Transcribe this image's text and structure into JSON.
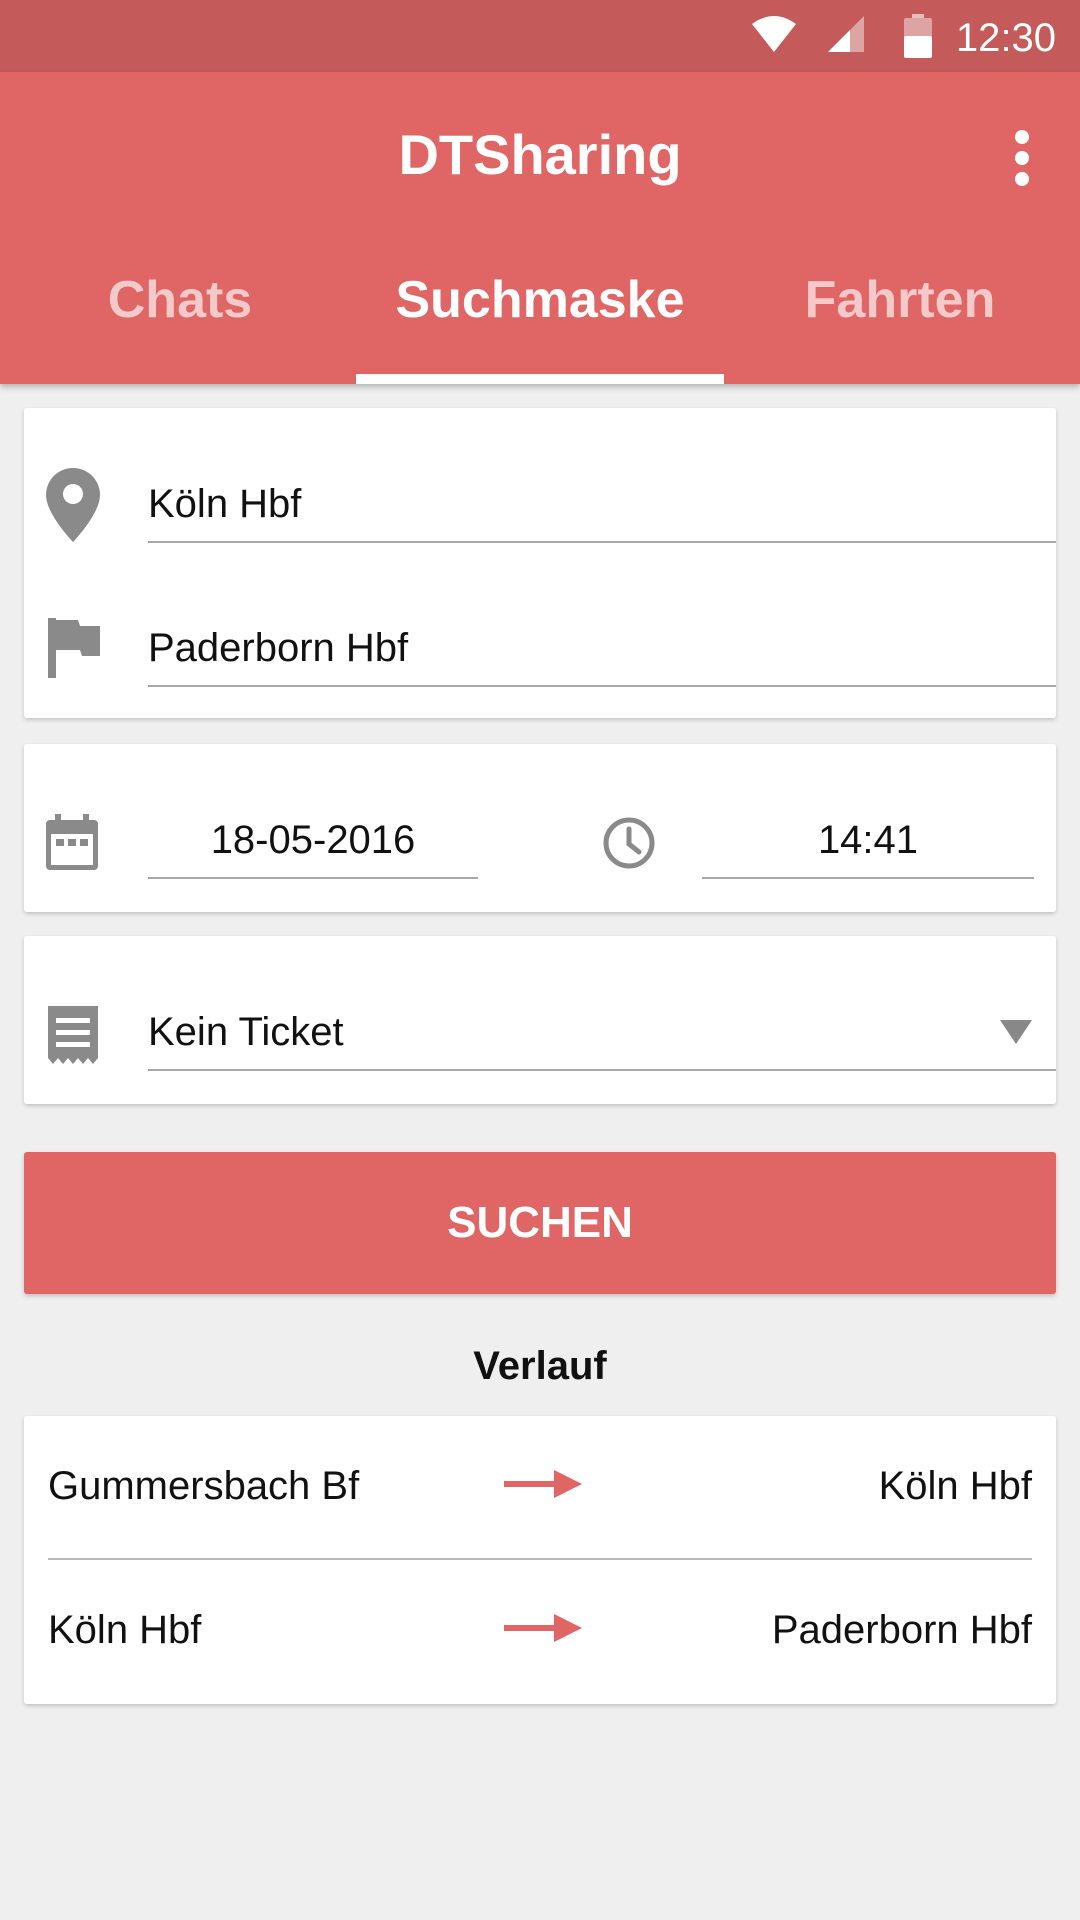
{
  "status_bar": {
    "time": "12:30"
  },
  "app_bar": {
    "title": "DTSharing"
  },
  "tabs": [
    {
      "label": "Chats",
      "active": false
    },
    {
      "label": "Suchmaske",
      "active": true
    },
    {
      "label": "Fahrten",
      "active": false
    }
  ],
  "search_form": {
    "from": "Köln Hbf",
    "to": "Paderborn Hbf",
    "date": "18-05-2016",
    "time": "14:41",
    "ticket": "Kein Ticket",
    "submit_label": "SUCHEN"
  },
  "history": {
    "title": "Verlauf",
    "items": [
      {
        "from": "Gummersbach Bf",
        "to": "Köln Hbf"
      },
      {
        "from": "Köln Hbf",
        "to": "Paderborn Hbf"
      }
    ]
  },
  "colors": {
    "primary": "#e06565",
    "primary_dark": "#c45a5a",
    "icon_gray": "#8a8a8a",
    "background": "#efefef"
  },
  "icons": [
    "wifi-icon",
    "signal-icon",
    "battery-icon",
    "more-vert-icon",
    "location-pin-icon",
    "flag-icon",
    "calendar-icon",
    "clock-icon",
    "receipt-icon",
    "dropdown-arrow-icon",
    "arrow-right-icon"
  ]
}
